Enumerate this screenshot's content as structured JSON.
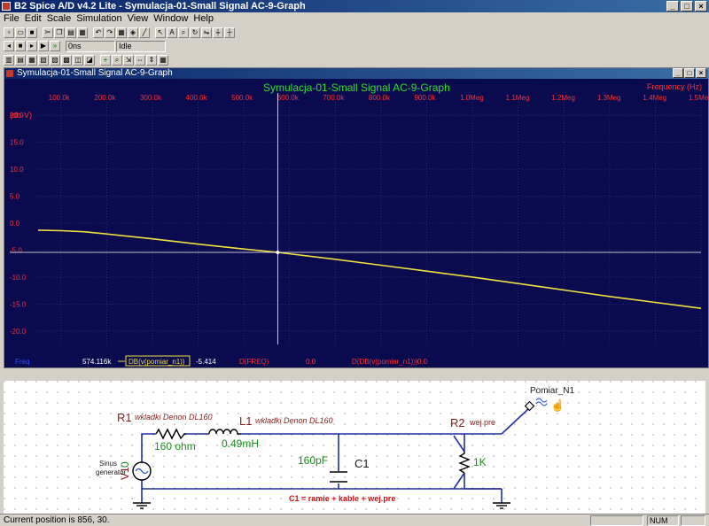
{
  "app": {
    "title": "B2 Spice A/D v4.2 Lite - Symulacja-01-Small Signal AC-9-Graph",
    "window_buttons": [
      "_",
      "□",
      "×"
    ]
  },
  "menu": [
    "File",
    "Edit",
    "Scale",
    "Simulation",
    "View",
    "Window",
    "Help"
  ],
  "toolbar2": {
    "time_field": "0ns",
    "state_field": "Idle"
  },
  "graph": {
    "window_title": "Symulacja-01-Small Signal AC-9-Graph",
    "plot_title": "Symulacja-01-Small Signal AC-9-Graph",
    "x_axis_label": "Frequency (Hz)",
    "y_axis_label": "(db-V)",
    "x_ticks": [
      "100.0k",
      "200.0k",
      "300.0k",
      "400.0k",
      "500.0k",
      "600.0k",
      "700.0k",
      "800.0k",
      "900.0k",
      "1.0Meg",
      "1.1Meg",
      "1.2Meg",
      "1.3Meg",
      "1.4Meg",
      "1.5Meg"
    ],
    "y_ticks": [
      "20.0",
      "15.0",
      "10.0",
      "5.0",
      "0.0",
      "-5.0",
      "-10.0",
      "-15.0",
      "-20.0"
    ],
    "cursor": {
      "x_label": "Freq",
      "x_value": "574.116k",
      "trace_name": "DB(v(pomiar_n1))",
      "y_value": "-5.414",
      "dx_label": "D(FREQ)",
      "dx_value": "0.0",
      "dy_label": "D(DB(v(pomiar_n1)))",
      "dy_value": "0.0"
    },
    "colors": {
      "background": "#0a0a4e",
      "trace": "#f0e040",
      "grid": "#3a3a7a",
      "axis_text": "#ff3030",
      "title": "#30e030"
    }
  },
  "chart_data": {
    "type": "line",
    "title": "Symulacja-01-Small Signal AC-9-Graph",
    "xlabel": "Frequency (Hz)",
    "ylabel": "(db-V)",
    "xlim": [
      50000,
      1500000
    ],
    "ylim": [
      -22.5,
      22.5
    ],
    "grid": true,
    "series": [
      {
        "name": "DB(v(pomiar_n1))",
        "x": [
          50000,
          100000,
          150000,
          200000,
          300000,
          400000,
          500000,
          574116,
          700000,
          800000,
          900000,
          1000000,
          1100000,
          1200000,
          1300000,
          1400000,
          1500000
        ],
        "y": [
          -1.3,
          -1.4,
          -1.6,
          -2.0,
          -2.9,
          -3.9,
          -4.8,
          -5.414,
          -6.7,
          -7.8,
          -8.9,
          -10.0,
          -11.2,
          -12.4,
          -13.6,
          -14.7,
          -15.8
        ]
      }
    ]
  },
  "schematic": {
    "r1_name": "R1",
    "r1_note": "wkladki Denon DL160",
    "r1_value": "160 ohm",
    "l1_name": "L1",
    "l1_note": "wkladki Denon DL160",
    "l1_value": "0.49mH",
    "c1_value": "160pF",
    "c1_name": "C1",
    "r2_name": "R2",
    "r2_note": "wej pre",
    "r2_value": "1K",
    "source_name": "V1",
    "source_value": "0",
    "source_label_1": "Sinus",
    "source_label_2": "generator",
    "probe_name": "Pomiar_N1",
    "c1_caption": "C1 = ramie + kable + wej.pre"
  },
  "status": {
    "text": "Current position is 856, 30.",
    "num": "NUM"
  }
}
